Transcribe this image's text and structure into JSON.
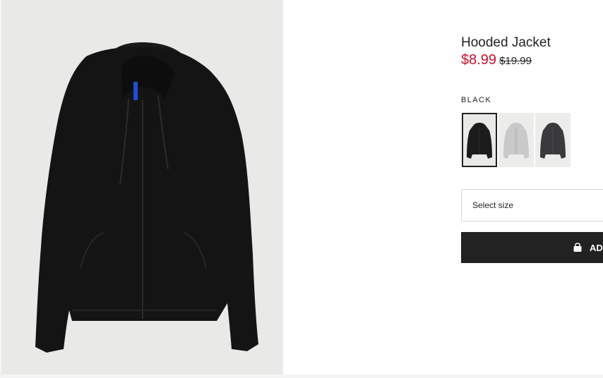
{
  "product": {
    "title": "Hooded Jacket",
    "sale_price": "$8.99",
    "original_price": "$19.99",
    "price_color": "#c8102e"
  },
  "color_selector": {
    "selected_color": "BLACK",
    "swatches": [
      {
        "name": "black",
        "hex": "#1c1c1c",
        "selected": true
      },
      {
        "name": "light-gray",
        "hex": "#c9c9c9",
        "selected": false
      },
      {
        "name": "dark-gray",
        "hex": "#3a3a3c",
        "selected": false
      }
    ]
  },
  "size_select": {
    "placeholder": "Select size"
  },
  "add_button": {
    "label": "AD",
    "icon": "shopping-bag-icon"
  }
}
